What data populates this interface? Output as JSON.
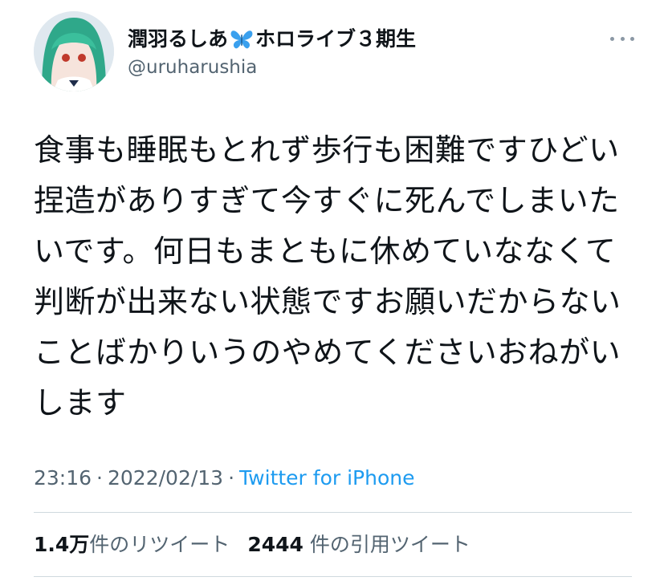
{
  "user": {
    "display_name_prefix": "潤羽るしあ",
    "display_name_emoji": "butterfly-icon",
    "display_name_suffix": "ホロライブ３期生",
    "handle": "@uruharushia"
  },
  "tweet": {
    "text": "食事も睡眠もとれず歩行も困難ですひどい捏造がありすぎて今すぐに死んでしまいたいです。何日もまともに休めていななくて判断が出来ない状態ですお願いだからないことばかりいうのやめてくださいおねがいします",
    "time": "23:16",
    "separator": "·",
    "date": "2022/02/13",
    "source": "Twitter for iPhone"
  },
  "stats": {
    "retweets_count": "1.4万",
    "retweets_label": "件のリツイート",
    "quotes_count": "2444",
    "quotes_label": "件の引用ツイート"
  },
  "colors": {
    "text": "#0f1419",
    "secondary": "#536471",
    "link": "#1d9bf0",
    "divider": "#cfd9de",
    "butterfly": "#3aa0ee"
  }
}
